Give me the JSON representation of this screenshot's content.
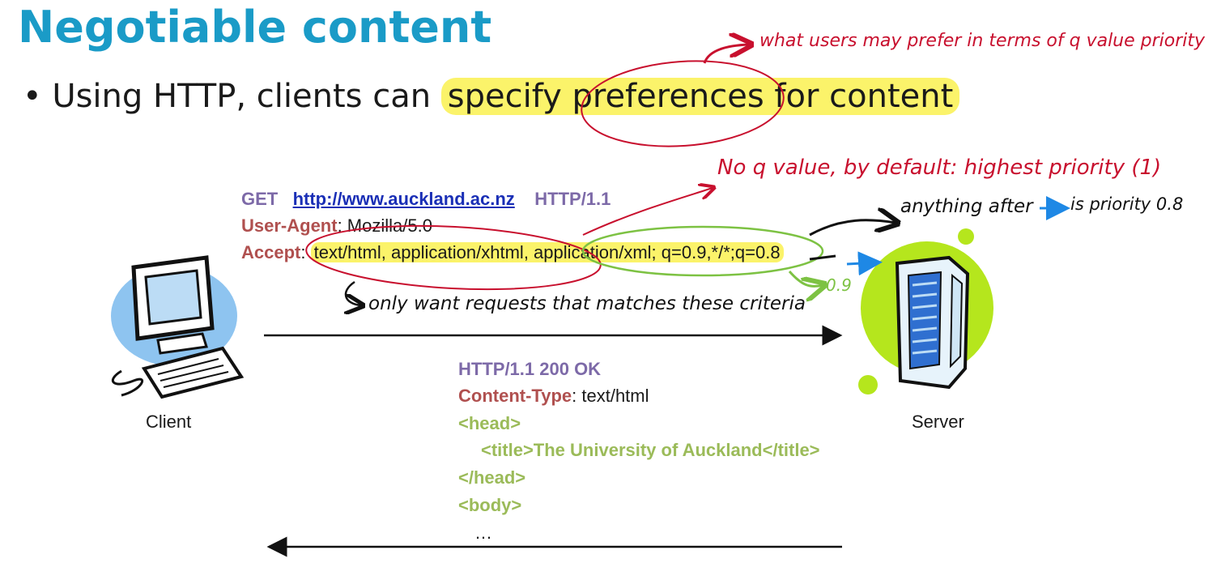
{
  "title": "Negotiable content",
  "bullet": {
    "marker": "•",
    "prefix": "Using HTTP, clients can ",
    "highlight": "specify preferences for content"
  },
  "request": {
    "method": "GET",
    "url": "http://www.auckland.ac.nz",
    "version": "HTTP/1.1",
    "ua_name": "User-Agent",
    "ua_value": ": Mozilla/5.0",
    "accept_name": "Accept",
    "accept_sep": ": ",
    "accept_value": "text/html, application/xhtml, application/xml; q=0.9,*/*;q=0.8"
  },
  "response": {
    "status": "HTTP/1.1 200 OK",
    "ct_name": "Content-Type",
    "ct_value": ": text/html",
    "lines": [
      "<head>",
      "<title>The University of Auckland</title>",
      "</head>",
      "<body>",
      "…"
    ]
  },
  "labels": {
    "client": "Client",
    "server": "Server"
  },
  "annotations": {
    "preferences": "what users may prefer in terms of q value priority",
    "no_q": "No q value, by default: highest priority (1)",
    "after": "anything after",
    "priority": "is priority 0.8",
    "only_want": "only want requests that matches these criteria",
    "q09": "0.9"
  },
  "colors": {
    "title": "#1a9bc7",
    "highlight": "#fbf36a",
    "ink_red": "#c8102e",
    "ink_green": "#7dc243",
    "ink_blue": "#1e88e5",
    "server_green": "#b5e61d"
  }
}
